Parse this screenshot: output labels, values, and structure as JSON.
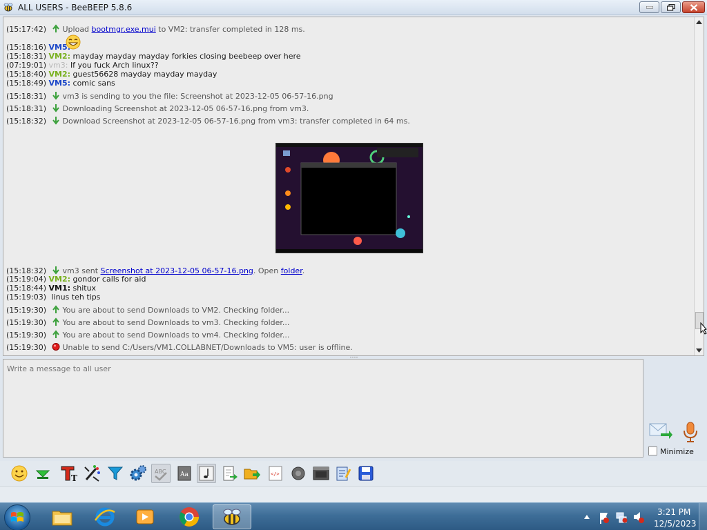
{
  "window": {
    "title": "ALL USERS - BeeBEEP 5.8.6"
  },
  "chat": {
    "lines": [
      {
        "ts": "(15:17:42)",
        "pre": "Upload ",
        "link": "bootmgr.exe.mui",
        "post": " to VM2: transfer completed in 128 ms."
      },
      {
        "ts": "(15:18:16)",
        "user": "VM5:"
      },
      {
        "ts": "(15:18:31)",
        "user": "VM2:",
        "text": "mayday mayday mayday forkies closing beebeep over here"
      },
      {
        "ts": "(07:19:01)",
        "user": "vm3:",
        "text": "If you fuck Arch linux??"
      },
      {
        "ts": "(15:18:40)",
        "user": "VM2:",
        "text": "guest56628 mayday mayday mayday"
      },
      {
        "ts": "(15:18:49)",
        "user": "VM5:",
        "text": "comic sans"
      },
      {
        "ts": "(15:18:31)",
        "text": "vm3 is sending to you the file: Screenshot at 2023-12-05 06-57-16.png"
      },
      {
        "ts": "(15:18:31)",
        "text": "Downloading Screenshot at 2023-12-05 06-57-16.png from vm3."
      },
      {
        "ts": "(15:18:32)",
        "text": "Download Screenshot at 2023-12-05 06-57-16.png from vm3: transfer completed in 64 ms."
      },
      {
        "ts": "(15:18:32)",
        "pre": "vm3 sent ",
        "link": "Screenshot at 2023-12-05 06-57-16.png",
        "mid": ". Open ",
        "link2": "folder",
        "post": "."
      },
      {
        "ts": "(15:19:04)",
        "user": "VM2:",
        "text": "gondor calls for aid"
      },
      {
        "ts": "(15:18:44)",
        "user": "VM1:",
        "text": "shitux"
      },
      {
        "ts": "(15:19:03)",
        "text": "linus teh tips"
      },
      {
        "ts": "(15:19:30)",
        "text": "You are about to send Downloads to VM2. Checking folder..."
      },
      {
        "ts": "(15:19:30)",
        "text": "You are about to send Downloads to vm3. Checking folder..."
      },
      {
        "ts": "(15:19:30)",
        "text": "You are about to send Downloads to vm4. Checking folder..."
      },
      {
        "ts": "(15:19:30)",
        "text": "Unable to send C:/Users/VM1.COLLABNET/Downloads to VM5: user is offline."
      }
    ]
  },
  "compose": {
    "placeholder": "Write a message to all user"
  },
  "options": {
    "minimize_label": "Minimize"
  },
  "clock": {
    "time": "3:21 PM",
    "date": "12/5/2023"
  },
  "colors": {
    "vm5": "#1a46c8",
    "vm2": "#78b01e",
    "vm3": "#b8b8b8",
    "link": "#0000cc"
  }
}
